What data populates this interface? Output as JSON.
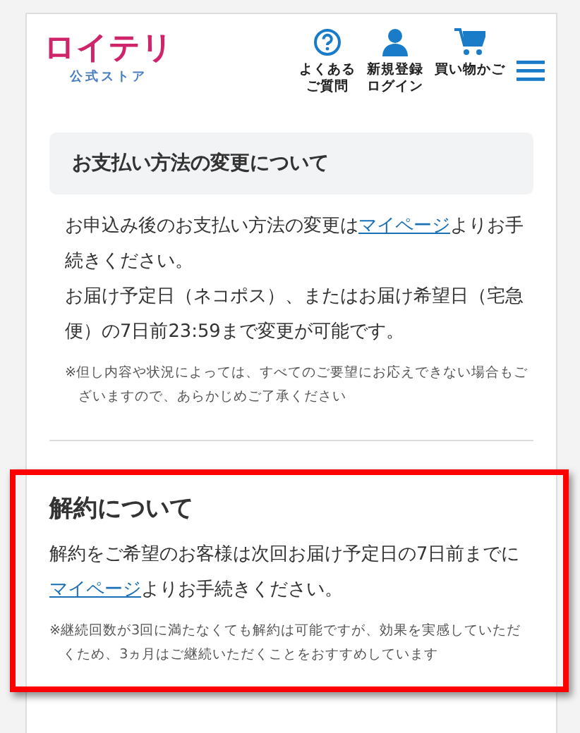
{
  "header": {
    "logo": "ロイテリ",
    "logo_sub": "公式ストア",
    "nav": [
      {
        "kind": "faq",
        "lines": [
          "よくある",
          "ご質問"
        ]
      },
      {
        "kind": "account",
        "lines": [
          "新規登録",
          "ログイン"
        ]
      },
      {
        "kind": "cart",
        "lines": [
          "買い物かご"
        ]
      }
    ]
  },
  "sections": [
    {
      "kind": "boxed",
      "title": "お支払い方法の変更について",
      "paragraphs": [
        [
          "お申込み後のお支払い方法の変更は",
          {
            "link": "マイページ"
          },
          "よりお手続きください。"
        ],
        [
          "お届け予定日（ネコポス）、またはお届け希望日（宅急便）の7日前23:59まで変更が可能です。"
        ]
      ],
      "note": "※但し内容や状況によっては、すべてのご要望にお応えできない場合もございますので、あらかじめご了承ください",
      "highlighted": false
    },
    {
      "kind": "plain",
      "title": "解約について",
      "paragraphs": [
        [
          "解約をご希望のお客様は次回お届け予定日の7日前までに",
          {
            "link": "マイページ"
          },
          "よりお手続きください。"
        ]
      ],
      "note": "※継続回数が3回に満たなくても解約は可能ですが、効果を実感していただくため、3ヵ月はご継続いただくことをおすすめしています",
      "highlighted": true
    }
  ]
}
